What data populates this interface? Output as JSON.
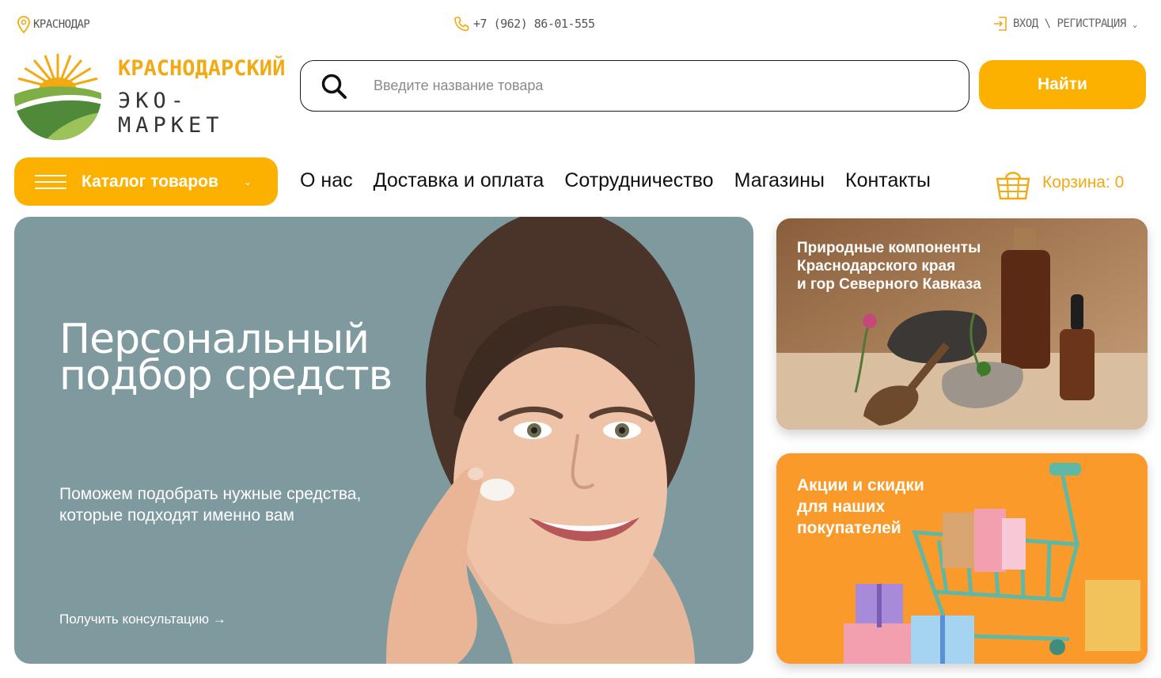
{
  "topbar": {
    "city": "КРАСНОДАР",
    "phone": "+7 (962) 86-01-555",
    "login": "ВХОД \\ РЕГИСТРАЦИЯ"
  },
  "logo": {
    "line1": "КРАСНОДАРСКИЙ",
    "line2": "ЭКО-МАРКЕТ"
  },
  "search": {
    "placeholder": "Введите название товара",
    "button": "Найти"
  },
  "nav": {
    "catalog": "Каталог товаров",
    "items": [
      "О нас",
      "Доставка и оплата",
      "Сотрудничество",
      "Магазины",
      "Контакты"
    ],
    "cart": "Корзина: 0"
  },
  "hero": {
    "title_line1": "Персональный",
    "title_line2": "подбор средств",
    "sub_line1": "Поможем подобрать нужные средства,",
    "sub_line2": "которые подходят именно вам",
    "link": "Получить консультацию →"
  },
  "cards": [
    {
      "lines": [
        "Природные компоненты",
        "Краснодарского края",
        "и гор Северного Кавказа"
      ]
    },
    {
      "lines": [
        "Акции и скидки",
        "для наших",
        "покупателей"
      ]
    }
  ],
  "colors": {
    "accent": "#fcb000",
    "logo_orange": "#f3a912",
    "logo_green": "#4f8a3a",
    "hero_bg": "#7f9a9f",
    "card_brown": "#a27953",
    "card_orange": "#fa9a2a"
  },
  "icons": {
    "city": "map-pin-icon",
    "phone": "phone-icon",
    "login": "login-icon",
    "search": "search-icon",
    "menu": "hamburger-icon",
    "cart": "basket-icon"
  }
}
